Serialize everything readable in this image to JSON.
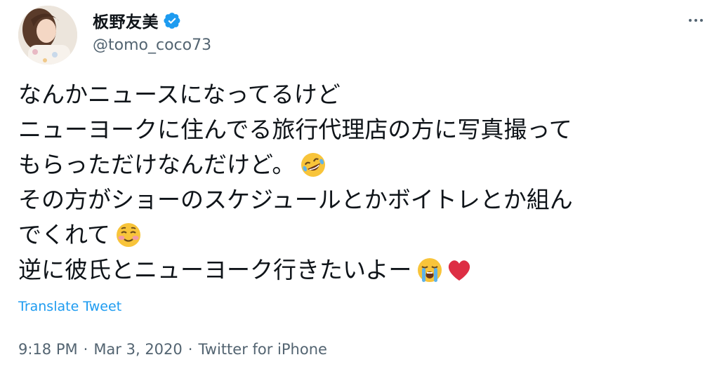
{
  "tweet": {
    "author": {
      "display_name": "板野友美",
      "handle": "@tomo_coco73",
      "verified_icon": "verified-badge-icon"
    },
    "more_icon": "more-horizontal-icon",
    "text_lines": [
      "なんかニュースになってるけど",
      "ニューヨークに住んでる旅行代理店の方に写真撮って",
      "もらっただけなんだけど。",
      "その方がショーのスケジュールとかボイトレとか組ん",
      "でくれて",
      "逆に彼氏とニューヨーク行きたいよー"
    ],
    "emojis": {
      "line3": "rolling-on-floor-laughing-emoji",
      "line5": "smiling-face-emoji",
      "line6a": "loudly-crying-face-emoji",
      "line6b": "red-heart-emoji"
    },
    "translate_label": "Translate Tweet",
    "time": "9:18 PM",
    "date": "Mar 3, 2020",
    "source": "Twitter for iPhone",
    "separator": "·"
  },
  "colors": {
    "accent": "#1d9bf0",
    "text": "#0f1419",
    "muted": "#536471"
  }
}
